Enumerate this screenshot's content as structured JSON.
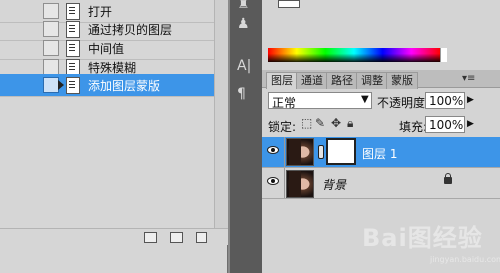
{
  "history": {
    "items": [
      {
        "label": "打开",
        "selected": false
      },
      {
        "label": "通过拷贝的图层",
        "selected": false
      },
      {
        "label": "中间值",
        "selected": false
      },
      {
        "label": "特殊模糊",
        "selected": false
      },
      {
        "label": "添加图层蒙版",
        "selected": true
      }
    ],
    "icons": [
      "new-document-from-state-icon",
      "new-snapshot-icon",
      "trash-icon"
    ]
  },
  "toolstrip": {
    "icons": [
      "brush-preset-icon",
      "clone-source-icon",
      "character-icon",
      "paragraph-icon"
    ],
    "character_glyph": "A|",
    "paragraph_glyph": "¶"
  },
  "layers_panel": {
    "tabs": [
      "图层",
      "通道",
      "路径",
      "调整",
      "蒙版"
    ],
    "active_tab": "图层",
    "menu_glyph": "▾≡",
    "blend_mode": "正常",
    "opacity_label": "不透明度:",
    "opacity_value": "100%",
    "lock_label": "锁定:",
    "fill_label": "填充:",
    "fill_value": "100%",
    "layers": [
      {
        "name": "图层 1",
        "visible": true,
        "selected": true,
        "has_mask": true
      },
      {
        "name": "背景",
        "visible": true,
        "selected": false,
        "locked": true
      }
    ]
  },
  "colors": {
    "selection": "#3d95e8",
    "panel": "#d4d4d4"
  },
  "watermark": {
    "text": "Bai图经验",
    "url": "jingyan.baidu.com"
  }
}
